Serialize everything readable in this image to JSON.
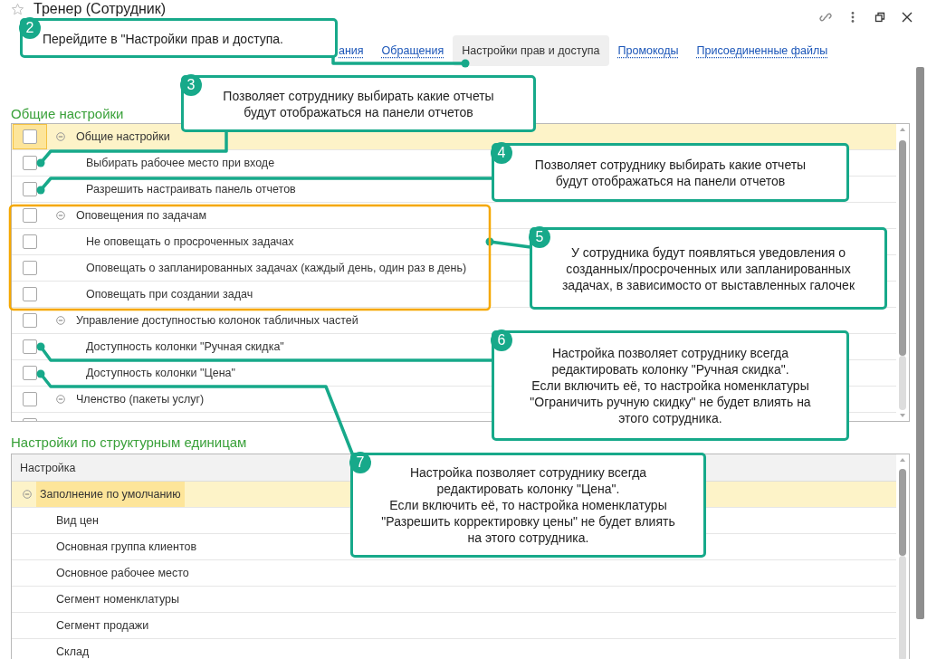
{
  "window": {
    "title": "Тренер (Сотрудник)"
  },
  "tabs": [
    {
      "label": "ания",
      "selected": false
    },
    {
      "label": "Обращения",
      "selected": false
    },
    {
      "label": "Настройки прав и доступа",
      "selected": true
    },
    {
      "label": "Промокоды",
      "selected": false
    },
    {
      "label": "Присоединенные файлы",
      "selected": false
    }
  ],
  "general_settings": {
    "heading": "Общие настройки",
    "rows": [
      {
        "label": "Общие настройки",
        "checked": false,
        "expanded": true,
        "selected": true,
        "children": [
          {
            "label": "Выбирать рабочее место при входе",
            "checked": false
          },
          {
            "label": "Разрешить настраивать панель отчетов",
            "checked": false
          }
        ]
      },
      {
        "label": "Оповещения по задачам",
        "checked": false,
        "expanded": true,
        "selected": false,
        "children": [
          {
            "label": "Не оповещать о просроченных задачах",
            "checked": false
          },
          {
            "label": "Оповещать о запланированных задачах (каждый день, один раз в день)",
            "checked": false
          },
          {
            "label": "Оповещать при создании задач",
            "checked": false
          }
        ]
      },
      {
        "label": "Управление доступностью колонок табличных частей",
        "checked": false,
        "expanded": true,
        "selected": false,
        "children": [
          {
            "label": "Доступность колонки \"Ручная скидка\"",
            "checked": false
          },
          {
            "label": "Доступность колонки \"Цена\"",
            "checked": false
          }
        ]
      },
      {
        "label": "Членство (пакеты услуг)",
        "checked": false,
        "expanded": true,
        "selected": false
      }
    ]
  },
  "unit_settings": {
    "heading": "Настройки по структурным единицам",
    "columns": [
      "Настройка"
    ],
    "rows": [
      {
        "label": "Заполнение по умолчанию",
        "expanded": true,
        "selected": true,
        "children": [
          {
            "label": "Вид цен"
          },
          {
            "label": "Основная группа клиентов"
          },
          {
            "label": "Основное рабочее место"
          },
          {
            "label": "Сегмент номенклатуры"
          },
          {
            "label": "Сегмент продажи"
          },
          {
            "label": "Склад"
          }
        ]
      }
    ]
  },
  "callouts": [
    {
      "number": "2",
      "text": "Перейдите в \"Настройки прав и доступа."
    },
    {
      "number": "3",
      "text": "Позволяет сотруднику выбирать какие отчеты\nбудут отображаться на панели отчетов"
    },
    {
      "number": "4",
      "text": "Позволяет сотруднику выбирать какие отчеты\nбудут отображаться на панели отчетов"
    },
    {
      "number": "5",
      "text": "У сотрудника будут появляться уведовления о\nсозданных/просроченных или запланированных\nзадачах, в зависимосто от выставленных галочек"
    },
    {
      "number": "6",
      "text": "Настройка позволяет сотруднику всегда\nредактировать колонку \"Ручная скидка\".\nЕсли включить её, то настройка номенклатуры\n\"Ограничить ручную скидку\" не будет влиять на\nэтого сотрудника."
    },
    {
      "number": "7",
      "text": "Настройка позволяет сотруднику всегда\nредактировать колонку \"Цена\".\nЕсли включить её, то настройка номенклатуры\n\"Разрешить корректировку цены\" не будет влиять\nна этого сотрудника."
    }
  ]
}
